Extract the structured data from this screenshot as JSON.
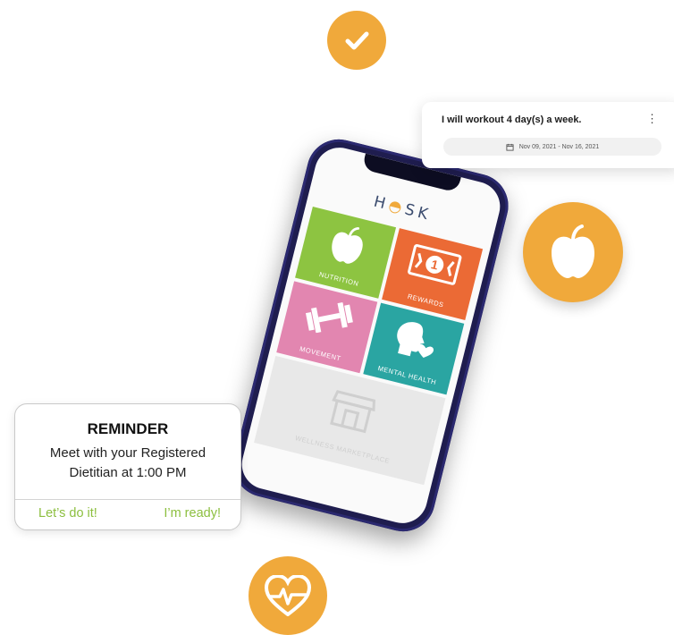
{
  "badges": {
    "check": {
      "icon": "checkmark-icon",
      "color": "#f0a93b"
    },
    "apple": {
      "icon": "apple-icon",
      "color": "#f0a93b"
    },
    "heart": {
      "icon": "heartbeat-icon",
      "color": "#f0a93b"
    }
  },
  "app": {
    "logo_text": "HUSK",
    "logo_prefix": "H",
    "logo_suffix": "SK",
    "tiles": [
      {
        "label": "NUTRITION",
        "icon": "apple-icon",
        "color": "#8dc441"
      },
      {
        "label": "REWARDS",
        "icon": "banknote-icon",
        "color": "#eb6a35"
      },
      {
        "label": "MOVEMENT",
        "icon": "dumbbell-icon",
        "color": "#e286b0"
      },
      {
        "label": "MENTAL HEALTH",
        "icon": "head-heart-icon",
        "color": "#2aa5a2"
      },
      {
        "label": "WELLNESS MARKETPLACE",
        "icon": "storefront-icon",
        "color": "#e8e8e8"
      }
    ]
  },
  "goal_card": {
    "title": "I will workout 4 day(s) a week.",
    "date_range": "Nov 09, 2021 - Nov 16, 2021",
    "menu_icon": "more-vertical-icon"
  },
  "reminder": {
    "title": "REMINDER",
    "line1": "Meet with your Registered",
    "line2": "Dietitian at 1:00 PM",
    "btn_left": "Let’s do it!",
    "btn_right": "I’m ready!",
    "accent": "#8cbf3f"
  }
}
